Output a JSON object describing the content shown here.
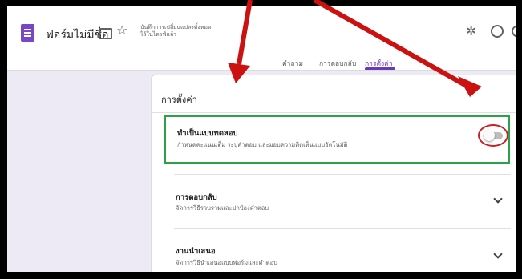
{
  "header": {
    "title": "ฟอร์มไม่มีชื่อ",
    "save_status_line1": "บันทึกการเปลี่ยนแปลงทั้งหมด",
    "save_status_line2": "ไว้ในไดรฟ์แล้ว"
  },
  "tabs": [
    {
      "label": "คำถาม",
      "active": false
    },
    {
      "label": "การตอบกลับ",
      "active": false
    },
    {
      "label": "การตั้งค่า",
      "active": true
    }
  ],
  "settings": {
    "heading": "การตั้งค่า",
    "quiz": {
      "title": "ทำเป็นแบบทดสอบ",
      "description": "กำหนดคะแนนเต็ม ระบุคำตอบ และมอบความคิดเห็นแบบอัตโนมัติ",
      "enabled": false
    },
    "responses": {
      "title": "การตอบกลับ",
      "description": "จัดการวิธีรวบรวมและปกป้องคำตอบ"
    },
    "presentation": {
      "title": "งานนำเสนอ",
      "description": "จัดการวิธีนำเสนอแบบฟอร์มและคำตอบ"
    }
  },
  "annotation_colors": {
    "arrow": "#cc1111",
    "highlight_box": "#2da04a",
    "toggle_circle": "#c92121",
    "accent": "#673ab7"
  }
}
